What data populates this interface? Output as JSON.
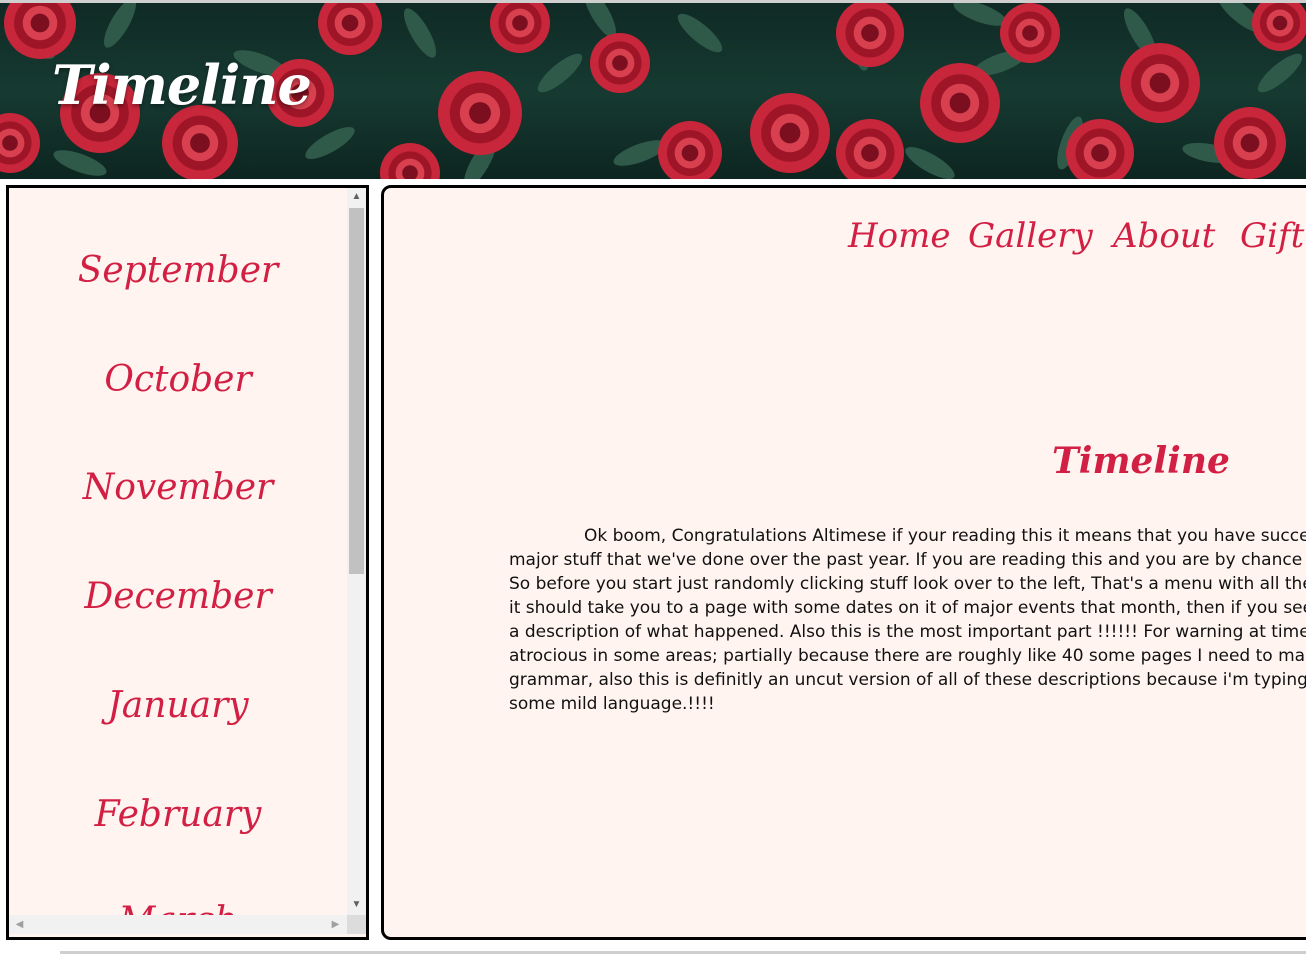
{
  "header": {
    "title": "Timeline"
  },
  "sidebar": {
    "months": [
      "September",
      "October",
      "November",
      "December",
      "January",
      "February",
      "March"
    ]
  },
  "nav": {
    "items": [
      "Home",
      "Gallery",
      "About",
      "Gift"
    ]
  },
  "main": {
    "title": "Timeline",
    "text_lines": [
      "Ok boom, Congratulations Altimese if your reading this it means that you have successfull",
      "major stuff that we've done over the past year. If you are reading this and you are by chance not Jal",
      "So before you start just randomly clicking stuff look over to the left, That's a menu with all the mon",
      "it should take you to a page with some dates on it of major events that month, then if you see one",
      "a description of what happened. Also this is the most important part !!!!!! For warning at times this",
      "atrocious in some areas; partially because there are roughly like 40 some pages I need to make a de",
      "grammar, also this is definitly an uncut version of all of these descriptions because i'm typing the de",
      "some mild language.!!!!"
    ]
  },
  "colors": {
    "accent": "#d21f44",
    "panel_bg": "#fff4ef",
    "banner_bg": "#163a31",
    "rose": "#c8263a"
  },
  "icons": {
    "scroll_up": "triangle-up-icon",
    "scroll_down": "triangle-down-icon",
    "scroll_left": "triangle-left-icon",
    "scroll_right": "triangle-right-icon"
  }
}
